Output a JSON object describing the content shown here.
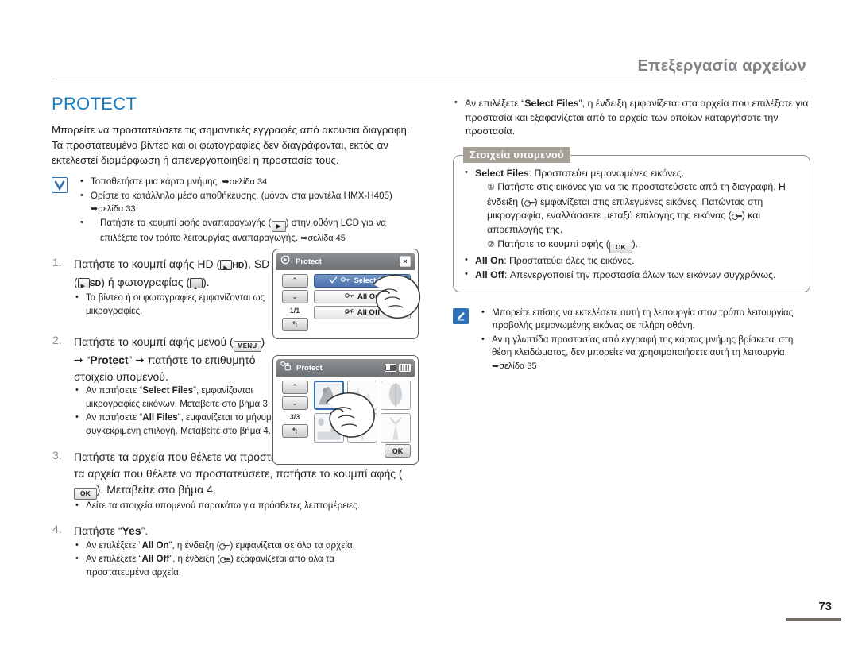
{
  "header": {
    "title": "Επεξεργασία αρχείων"
  },
  "colors": {
    "heading": "#1b7cc2",
    "header_title": "#808386",
    "submenu_tag_bg": "#a6a196",
    "selected_menu": "#4c72ad",
    "page_bar": "#736f63"
  },
  "section": {
    "title": "PROTECT",
    "intro": "Μπορείτε να προστατεύσετε τις σημαντικές εγγραφές από ακούσια διαγραφή. Τα προστατευμένα βίντεο και οι φωτογραφίες δεν διαγράφονται, εκτός αν εκτελεστεί διαμόρφωση ή απενεργοποιηθεί η προστασία τους."
  },
  "precheck": {
    "icon": "checkmark-icon",
    "items": [
      {
        "pre": "Τοποθετήστε μια κάρτα μνήμης. ",
        "link": "➥σελίδα 34",
        "post": ""
      },
      {
        "pre": "Ορίστε το κατάλληλο μέσο αποθήκευσης. (μόνον στα μοντέλα HMX-H405) ",
        "link": "➥σελίδα 33",
        "post": ""
      },
      {
        "pre": "Πατήστε το κουμπί αφής αναπαραγωγής (",
        "mid": ") στην οθόνη LCD για να επιλέξετε τον τρόπο λειτουργίας αναπαραγωγής. ",
        "link": "➥σελίδα 45",
        "post": ""
      }
    ]
  },
  "steps": [
    {
      "num": "1.",
      "text_a": "Πατήστε το κουμπί αφής HD (",
      "hd_label": "HD",
      "text_b": "), SD (",
      "sd_label": "SD",
      "text_c": ") ή φωτογραφίας (",
      "text_d": ").",
      "subs": [
        "Τα βίντεο ή οι φωτογραφίες εμφανίζονται ως μικρογραφίες."
      ]
    },
    {
      "num": "2.",
      "text_a": "Πατήστε το κουμπί αφής μενού (",
      "menu_label": "MENU",
      "text_b": ") ➞ “",
      "protect_label": "Protect",
      "text_c": "” ➞ πατήστε το επιθυμητό στοιχείο υπομενού.",
      "subs_rich": [
        {
          "a": "Αν πατήσετε “",
          "b": "Select Files",
          "c": "”, εμφανίζονται μικρογραφίες εικόνων. Μεταβείτε στο βήμα 3."
        },
        {
          "a": "Αν πατήσετε “",
          "b": "All Files",
          "c": "”, εμφανίζεται το μήνυμα που αντιστοιχεί στη συγκεκριμένη επιλογή. Μεταβείτε στο βήμα 4."
        }
      ]
    },
    {
      "num": "3.",
      "text_a": "Πατήστε τα αρχεία που θέλετε να προστατεύσετε. Αφού επιλέξετε όλα τα αρχεία που θέλετε να προστατεύσετε, πατήστε το κουμπί αφής (",
      "ok_label": "OK",
      "text_b": "). Μεταβείτε στο βήμα 4.",
      "subs": [
        "Δείτε τα στοιχεία υπομενού παρακάτω για πρόσθετες λεπτομέρειες."
      ]
    },
    {
      "num": "4.",
      "text_a": "Πατήστε “",
      "yes_label": "Yes",
      "text_b": "”.",
      "subs_rich": [
        {
          "a": "Αν επιλέξετε “",
          "b": "All On",
          "c": "”, η ένδειξη (",
          "d": ") εμφανίζεται σε όλα τα αρχεία."
        },
        {
          "a": "Αν επιλέξετε “",
          "b": "All Off",
          "c": "”, η ένδειξη (",
          "d": ") εξαφανίζεται από όλα τα προστατευμένα αρχεία."
        }
      ]
    }
  ],
  "device1": {
    "title": "Protect",
    "title_icon": "playback-protect-icon",
    "close_icon": "×",
    "up_icon": "⌃",
    "down_icon": "⌄",
    "back_icon": "↰",
    "page_count": "1/1",
    "menu_items": [
      {
        "label": "Select Files",
        "selected": true,
        "check": true
      },
      {
        "label": "All On",
        "selected": false,
        "check": false
      },
      {
        "label": "All Off",
        "selected": false,
        "check": false
      }
    ]
  },
  "device2": {
    "title": "Protect",
    "title_icon": "protect-key-icon",
    "up_icon": "⌃",
    "down_icon": "⌄",
    "back_icon": "↰",
    "page_count": "3/3",
    "ok_label": "OK",
    "thumbs": [
      {
        "selected": true,
        "tagged": true
      },
      {
        "selected": false,
        "tagged": false
      },
      {
        "selected": false,
        "tagged": false
      },
      {
        "selected": false,
        "tagged": false
      },
      {
        "selected": false,
        "tagged": false
      },
      {
        "selected": false,
        "tagged": false
      }
    ]
  },
  "right": {
    "top_bullet": {
      "a": "Αν επιλέξετε “",
      "b": "Select Files",
      "c": "”, η ένδειξη εμφανίζεται στα αρχεία που επιλέξατε για προστασία και εξαφανίζεται από τα αρχεία των οποίων καταργήσατε την προστασία."
    },
    "submenu": {
      "tag": "Στοιχεία υπομενού",
      "select_files": {
        "label": "Select Files",
        "desc": ": Προστατεύει μεμονωμένες εικόνες."
      },
      "sub1_marker": "①",
      "sub1_a": "Πατήστε στις εικόνες για να τις προστατεύσετε από τη διαγραφή. Η ένδειξη (",
      "sub1_b": ") εμφανίζεται στις επιλεγμένες εικόνες. Πατώντας στη μικρογραφία, εναλλάσσετε μεταξύ επιλογής της εικόνας (",
      "sub1_c": ") και αποεπιλογής της.",
      "sub2_marker": "②",
      "sub2_a": "Πατήστε το κουμπί αφής (",
      "sub2_ok": "OK",
      "sub2_b": ").",
      "all_on": {
        "label": "All On",
        "desc": ": Προστατεύει όλες τις εικόνες."
      },
      "all_off": {
        "label": "All Off",
        "desc": ": Απενεργοποιεί την προστασία όλων των εικόνων συγχρόνως."
      }
    },
    "note": {
      "icon": "note-pen-icon",
      "items": [
        {
          "text": "Μπορείτε επίσης να εκτελέσετε αυτή τη λειτουργία στον τρόπο λειτουργίας προβολής μεμονωμένης εικόνας σε πλήρη οθόνη.",
          "link": ""
        },
        {
          "text": "Αν η γλωττίδα προστασίας από εγγραφή της κάρτας μνήμης βρίσκεται στη θέση κλειδώματος, δεν μπορείτε να χρησιμοποιήσετε αυτή τη λειτουργία. ",
          "link": "➥σελίδα 35"
        }
      ]
    }
  },
  "footer": {
    "page_number": "73"
  }
}
